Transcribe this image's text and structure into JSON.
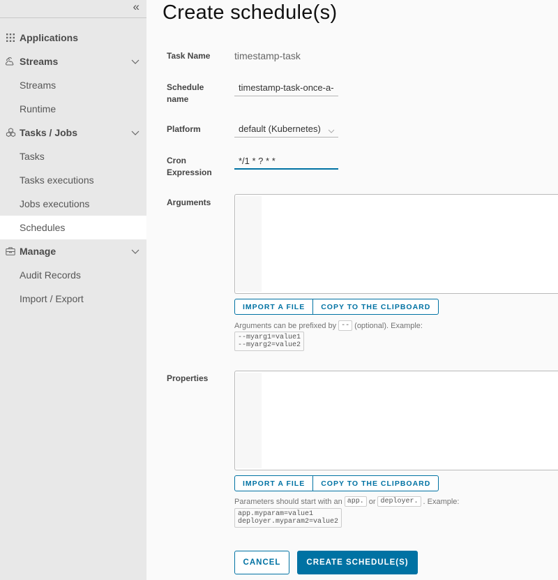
{
  "sidebar": {
    "collapse_icon": "double-chevron-left-icon",
    "collapse_glyph": "«",
    "groups": [
      {
        "label": "Applications",
        "icon": "grid-icon",
        "expandable": false,
        "items": []
      },
      {
        "label": "Streams",
        "icon": "streams-icon",
        "expandable": true,
        "items": [
          {
            "label": "Streams"
          },
          {
            "label": "Runtime"
          }
        ]
      },
      {
        "label": "Tasks / Jobs",
        "icon": "tasks-icon",
        "expandable": true,
        "items": [
          {
            "label": "Tasks"
          },
          {
            "label": "Tasks executions"
          },
          {
            "label": "Jobs executions"
          },
          {
            "label": "Schedules",
            "active": true
          }
        ]
      },
      {
        "label": "Manage",
        "icon": "briefcase-icon",
        "expandable": true,
        "items": [
          {
            "label": "Audit Records"
          },
          {
            "label": "Import / Export"
          }
        ]
      }
    ]
  },
  "page": {
    "title": "Create schedule(s)"
  },
  "form": {
    "task_name_label": "Task Name",
    "task_name_value": "timestamp-task",
    "schedule_name_label_1": "Schedule",
    "schedule_name_label_2": "name",
    "schedule_name_value": "timestamp-task-once-a-",
    "platform_label": "Platform",
    "platform_value": "default (Kubernetes)",
    "cron_label_1": "Cron",
    "cron_label_2": "Expression",
    "cron_value": "*/1 * ? * *",
    "arguments_label": "Arguments",
    "arguments_value": "",
    "properties_label": "Properties",
    "properties_value": "",
    "import_file_label": "IMPORT A FILE",
    "copy_clipboard_label": "COPY TO THE CLIPBOARD",
    "args_hint_prefix": "Arguments can be prefixed by",
    "args_hint_code": "--",
    "args_hint_suffix": "(optional). Example:",
    "args_example_line1": "--myarg1=value1",
    "args_example_line2": "--myarg2=value2",
    "props_hint_prefix": "Parameters should start with an",
    "props_hint_code1": "app.",
    "props_hint_or": "or",
    "props_hint_code2": "deployer.",
    "props_hint_suffix": ". Example:",
    "props_example_line1": "app.myparam=value1",
    "props_example_line2": "deployer.myparam2=value2"
  },
  "actions": {
    "cancel_label": "CANCEL",
    "create_label": "CREATE SCHEDULE(S)"
  },
  "colors": {
    "primary": "#0072a3",
    "sidebar_bg": "#e8e8e8",
    "active_item_bg": "#ffffff"
  }
}
